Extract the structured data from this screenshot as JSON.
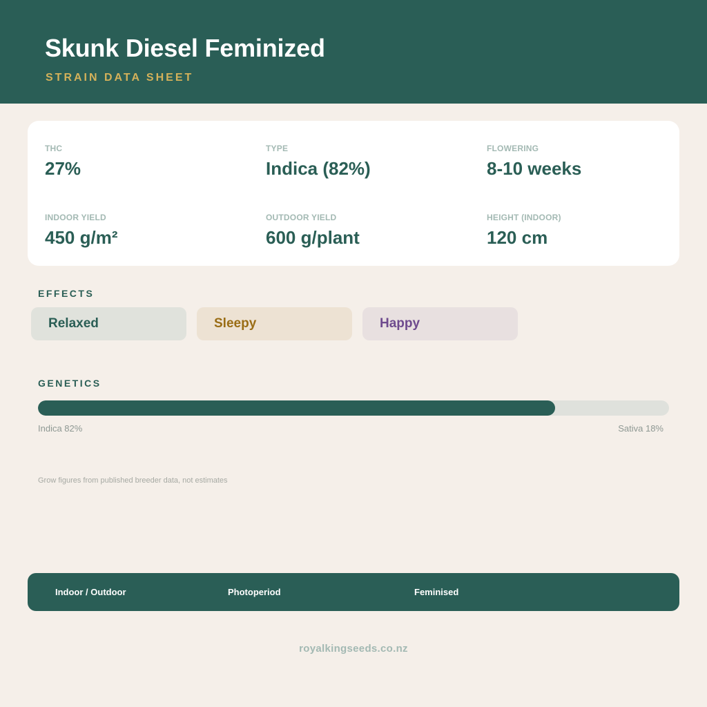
{
  "header": {
    "title": "Skunk Diesel Feminized",
    "subtitle": "STRAIN DATA SHEET"
  },
  "stats": [
    {
      "label": "THC",
      "value": "27%"
    },
    {
      "label": "TYPE",
      "value": "Indica (82%)"
    },
    {
      "label": "FLOWERING",
      "value": "8-10 weeks"
    },
    {
      "label": "INDOOR YIELD",
      "value": "450 g/m²"
    },
    {
      "label": "OUTDOOR YIELD",
      "value": "600 g/plant"
    },
    {
      "label": "HEIGHT (INDOOR)",
      "value": "120 cm"
    }
  ],
  "effects": {
    "heading": "EFFECTS",
    "items": [
      "Relaxed",
      "Sleepy",
      "Happy"
    ]
  },
  "genetics": {
    "heading": "GENETICS",
    "indica_percent": 82,
    "indica_label": "Indica 82%",
    "sativa_label": "Sativa 18%"
  },
  "note": "Grow figures from published breeder data, not estimates",
  "features": [
    "Indoor / Outdoor",
    "Photoperiod",
    "Feminised"
  ],
  "website": "royalkingseeds.co.nz",
  "colors": {
    "primary": "#2a5e56",
    "accent_gold": "#d4b15a",
    "background": "#f5efe9"
  }
}
